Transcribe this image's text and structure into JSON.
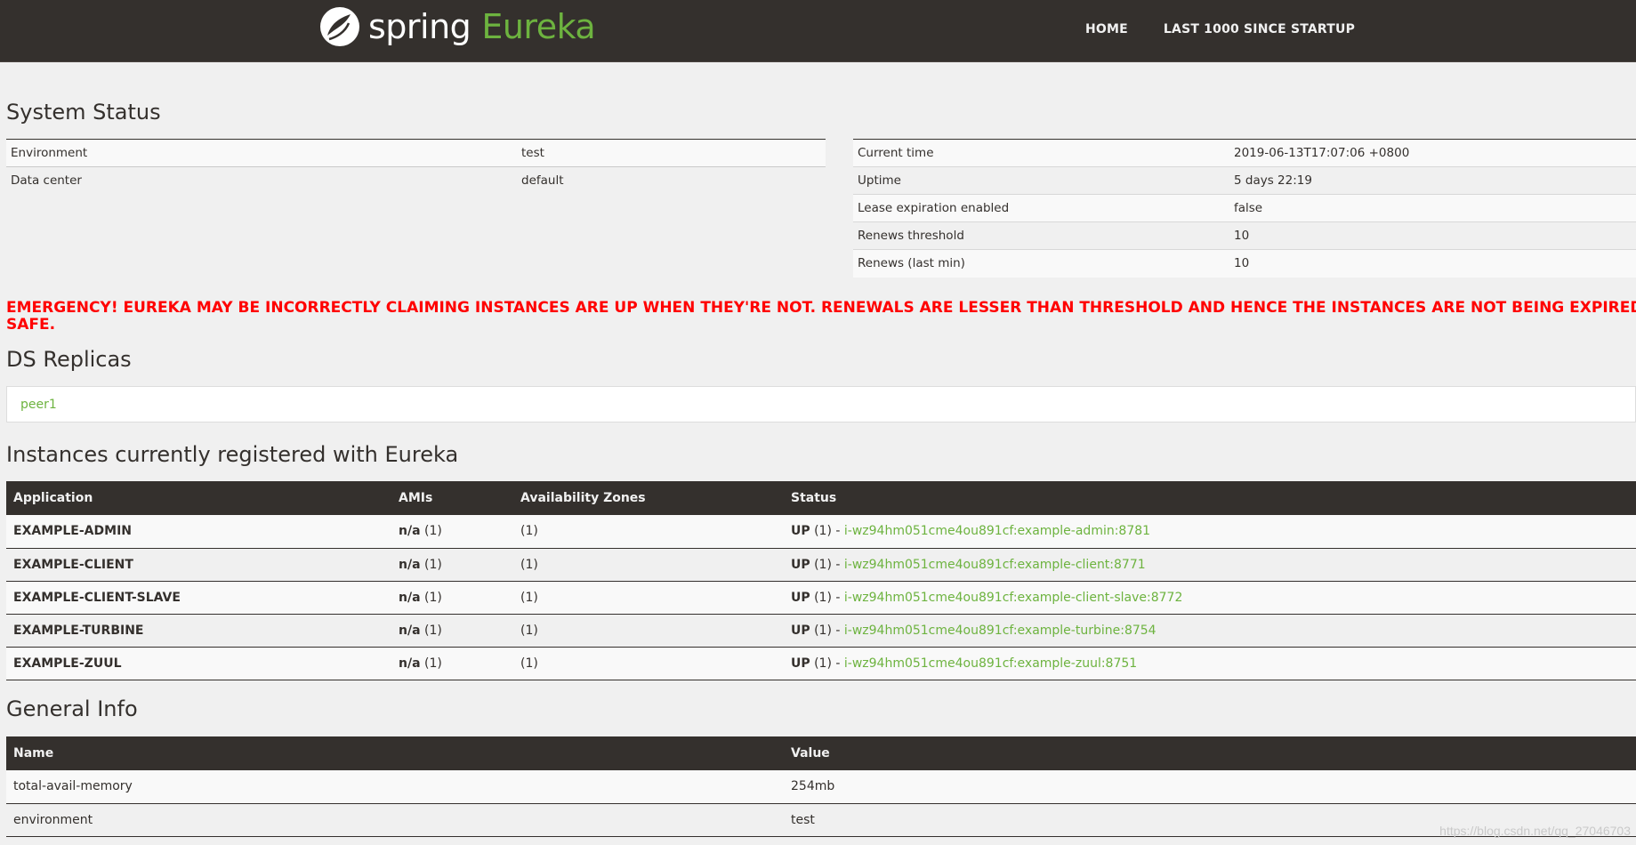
{
  "navbar": {
    "brand_spring": "spring",
    "brand_eureka": "Eureka",
    "links": [
      "HOME",
      "LAST 1000 SINCE STARTUP"
    ]
  },
  "system_status": {
    "title": "System Status",
    "left": [
      {
        "key": "Environment",
        "value": "test"
      },
      {
        "key": "Data center",
        "value": "default"
      }
    ],
    "right": [
      {
        "key": "Current time",
        "value": "2019-06-13T17:07:06 +0800"
      },
      {
        "key": "Uptime",
        "value": "5 days 22:19"
      },
      {
        "key": "Lease expiration enabled",
        "value": "false"
      },
      {
        "key": "Renews threshold",
        "value": "10"
      },
      {
        "key": "Renews (last min)",
        "value": "10"
      }
    ]
  },
  "emergency": {
    "line1": "EMERGENCY! EUREKA MAY BE INCORRECTLY CLAIMING INSTANCES ARE UP WHEN THEY'RE NOT. RENEWALS ARE LESSER THAN THRESHOLD AND HENCE THE INSTANCES ARE NOT BEING EXPIRED JUST TO BE",
    "line2": "SAFE."
  },
  "ds_replicas": {
    "title": "DS Replicas",
    "items": [
      "peer1"
    ]
  },
  "instances": {
    "title": "Instances currently registered with Eureka",
    "headers": [
      "Application",
      "AMIs",
      "Availability Zones",
      "Status"
    ],
    "rows": [
      {
        "app": "EXAMPLE-ADMIN",
        "amis": "n/a",
        "amis_count": "(1)",
        "zones": "(1)",
        "status": "UP",
        "status_count": "(1) -",
        "instance": "i-wz94hm051cme4ou891cf:example-admin:8781"
      },
      {
        "app": "EXAMPLE-CLIENT",
        "amis": "n/a",
        "amis_count": "(1)",
        "zones": "(1)",
        "status": "UP",
        "status_count": "(1) -",
        "instance": "i-wz94hm051cme4ou891cf:example-client:8771"
      },
      {
        "app": "EXAMPLE-CLIENT-SLAVE",
        "amis": "n/a",
        "amis_count": "(1)",
        "zones": "(1)",
        "status": "UP",
        "status_count": "(1) -",
        "instance": "i-wz94hm051cme4ou891cf:example-client-slave:8772"
      },
      {
        "app": "EXAMPLE-TURBINE",
        "amis": "n/a",
        "amis_count": "(1)",
        "zones": "(1)",
        "status": "UP",
        "status_count": "(1) -",
        "instance": "i-wz94hm051cme4ou891cf:example-turbine:8754"
      },
      {
        "app": "EXAMPLE-ZUUL",
        "amis": "n/a",
        "amis_count": "(1)",
        "zones": "(1)",
        "status": "UP",
        "status_count": "(1) -",
        "instance": "i-wz94hm051cme4ou891cf:example-zuul:8751"
      }
    ]
  },
  "general_info": {
    "title": "General Info",
    "headers": [
      "Name",
      "Value"
    ],
    "rows": [
      {
        "name": "total-avail-memory",
        "value": "254mb"
      },
      {
        "name": "environment",
        "value": "test"
      }
    ]
  },
  "watermark": "https://blog.csdn.net/qq_27046703",
  "colors": {
    "navbar_bg": "#34302d",
    "accent_green": "#6db33f",
    "emergency_red": "#ff0000",
    "page_bg": "#f0f0f0"
  }
}
